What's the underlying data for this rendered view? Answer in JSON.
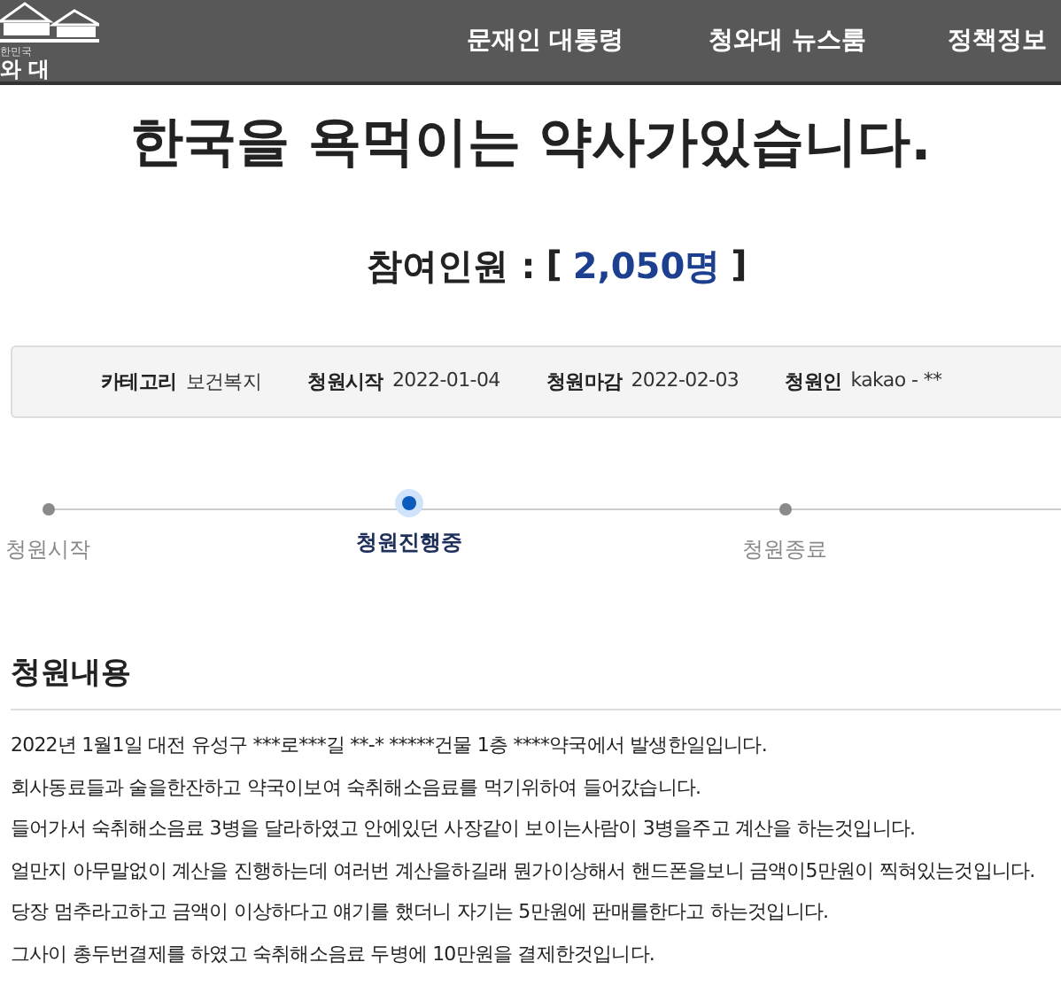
{
  "header": {
    "logo": {
      "small_text": "한민국",
      "name_text": "와 대"
    },
    "nav": [
      "문재인 대통령",
      "청와대 뉴스룸",
      "정책정보"
    ]
  },
  "petition": {
    "title": "한국을 욕먹이는 약사가있습니다.",
    "participants_label": "참여인원 :",
    "participants_open": "[",
    "participants_count": "2,050명",
    "participants_close": "]"
  },
  "info": [
    {
      "label": "카테고리",
      "value": "보건복지"
    },
    {
      "label": "청원시작",
      "value": "2022-01-04"
    },
    {
      "label": "청원마감",
      "value": "2022-02-03"
    },
    {
      "label": "청원인",
      "value": "kakao - **"
    }
  ],
  "progress": [
    {
      "label": "청원시작",
      "selected": false
    },
    {
      "label": "청원진행중",
      "selected": true
    },
    {
      "label": "청원종료",
      "selected": false
    }
  ],
  "content": {
    "heading": "청원내용",
    "lines": [
      "2022년 1월1일 대전 유성구 ***로***길 **-* *****건물 1층 ****약국에서 발생한일입니다.",
      "회사동료들과 술을한잔하고 약국이보여 숙취해소음료를 먹기위하여 들어갔습니다.",
      "들어가서 숙취해소음료 3병을 달라하였고 안에있던 사장같이 보이는사람이 3병을주고 계산을 하는것입니다.",
      "얼만지 아무말없이 계산을 진행하는데 여러번 계산을하길래 뭔가이상해서 핸드폰을보니 금액이5만원이 찍혀있는것입니다.",
      "당장 멈추라고하고 금액이 이상하다고 얘기를 했더니 자기는 5만원에 판매를한다고 하는것입니다.",
      "그사이 총두번결제를 하였고 숙취해소음료 두병에 10만원을 결제한것입니다."
    ]
  }
}
